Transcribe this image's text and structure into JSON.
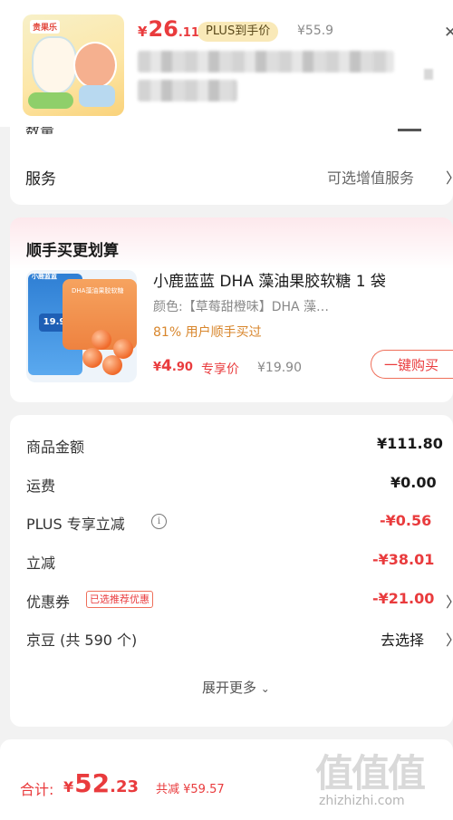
{
  "header": {
    "price_yen": "¥",
    "price_int": "26",
    "price_dec": ".11",
    "plus_label": "PLUS到手价",
    "original_price": "¥55.9",
    "close_icon": "close-icon",
    "thumb_brand": "贵果乐"
  },
  "partial_row": {
    "label": "数量"
  },
  "service": {
    "label": "服务",
    "value": "可选增值服务",
    "chevron": "chevron-right-icon"
  },
  "recommend": {
    "title": "顺手买更划算",
    "product_name": "小鹿蓝蓝 DHA 藻油果胶软糖 1 袋",
    "spec": "颜色:【草莓甜橙味】DHA 藻…",
    "bought": "81% 用户顺手买过",
    "price_yen": "¥",
    "price_int": "4",
    "price_dec": ".90",
    "price_tag": "专享价",
    "original_price": "¥19.90",
    "buy_button": "一键购买",
    "thumb_brand": "小鹿蓝蓝",
    "thumb_price": "19.9",
    "thumb_bag_text": "DHA藻油果胶软糖"
  },
  "details": {
    "items": [
      {
        "label": "商品金额",
        "value": "¥111.80"
      },
      {
        "label": "运费",
        "value": "¥0.00"
      },
      {
        "label": "PLUS 专享立减",
        "value": "-¥0.56"
      },
      {
        "label": "立减",
        "value": "-¥38.01"
      },
      {
        "label": "优惠券",
        "value": "-¥21.00",
        "badge": "已选推荐优惠"
      },
      {
        "label": "京豆 (共 590 个)",
        "value": "去选择"
      }
    ],
    "expand": "展开更多",
    "info_icon": "info-icon",
    "chevron": "chevron-right-icon"
  },
  "bottom": {
    "total_label": "合计:",
    "total_yen": "¥",
    "total_int": "52",
    "total_dec": ".23",
    "saved": "共减 ¥59.57"
  },
  "watermark": {
    "logo_text": "值值值",
    "url": "zhizhizhi.com"
  },
  "colors": {
    "accent_red": "#e93b3d",
    "bought_orange": "#d8862c",
    "plus_gold": "#f9e9b8",
    "background": "#f2f2f2"
  }
}
